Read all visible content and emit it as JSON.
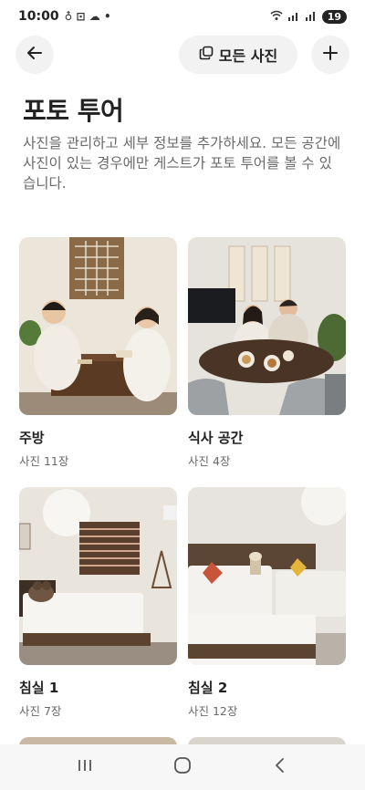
{
  "status_bar": {
    "time": "10:00",
    "battery": "19"
  },
  "header": {
    "all_photos_label": "모든 사진"
  },
  "page": {
    "title": "포토 투어",
    "description": "사진을 관리하고 세부 정보를 추가하세요. 모든 공간에 사진이 있는 경우에만 게스트가 포토 투어를 볼 수 있습니다."
  },
  "rooms": [
    {
      "title": "주방",
      "count": "사진 11장"
    },
    {
      "title": "식사 공간",
      "count": "사진 4장"
    },
    {
      "title": "침실 1",
      "count": "사진 7장"
    },
    {
      "title": "침실 2",
      "count": "사진 12장"
    }
  ],
  "icons": {
    "back": "arrow-left-icon",
    "all_photos": "photo-stack-icon",
    "add": "plus-icon",
    "nav_recent": "recent-apps-icon",
    "nav_home": "home-icon",
    "nav_back": "chevron-left-icon"
  },
  "colors": {
    "text_primary": "#222222",
    "text_secondary": "#6a6a6a",
    "button_bg": "#f2f2f2"
  }
}
